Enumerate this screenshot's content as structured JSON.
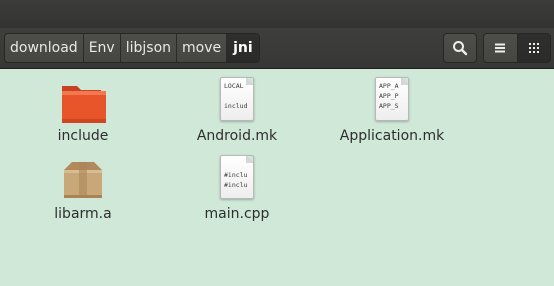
{
  "breadcrumb": [
    "download",
    "Env",
    "libjson",
    "move",
    "jni"
  ],
  "toolbar": {
    "search_icon": "search-icon",
    "list_view_icon": "list-view-icon",
    "grid_view_icon": "grid-view-icon"
  },
  "files": [
    {
      "name": "include",
      "type": "folder"
    },
    {
      "name": "Android.mk",
      "type": "text",
      "preview": [
        "LOCAL",
        "",
        "includ"
      ]
    },
    {
      "name": "Application.mk",
      "type": "text",
      "preview": [
        "APP_A",
        "APP_P",
        "APP_S"
      ]
    },
    {
      "name": "libarm.a",
      "type": "archive"
    },
    {
      "name": "main.cpp",
      "type": "source",
      "preview": [
        "#inclu",
        "#inclu"
      ]
    }
  ],
  "colors": {
    "background": "#cfe8d8",
    "folder": "#e8552a",
    "archive": "#c8a878"
  }
}
